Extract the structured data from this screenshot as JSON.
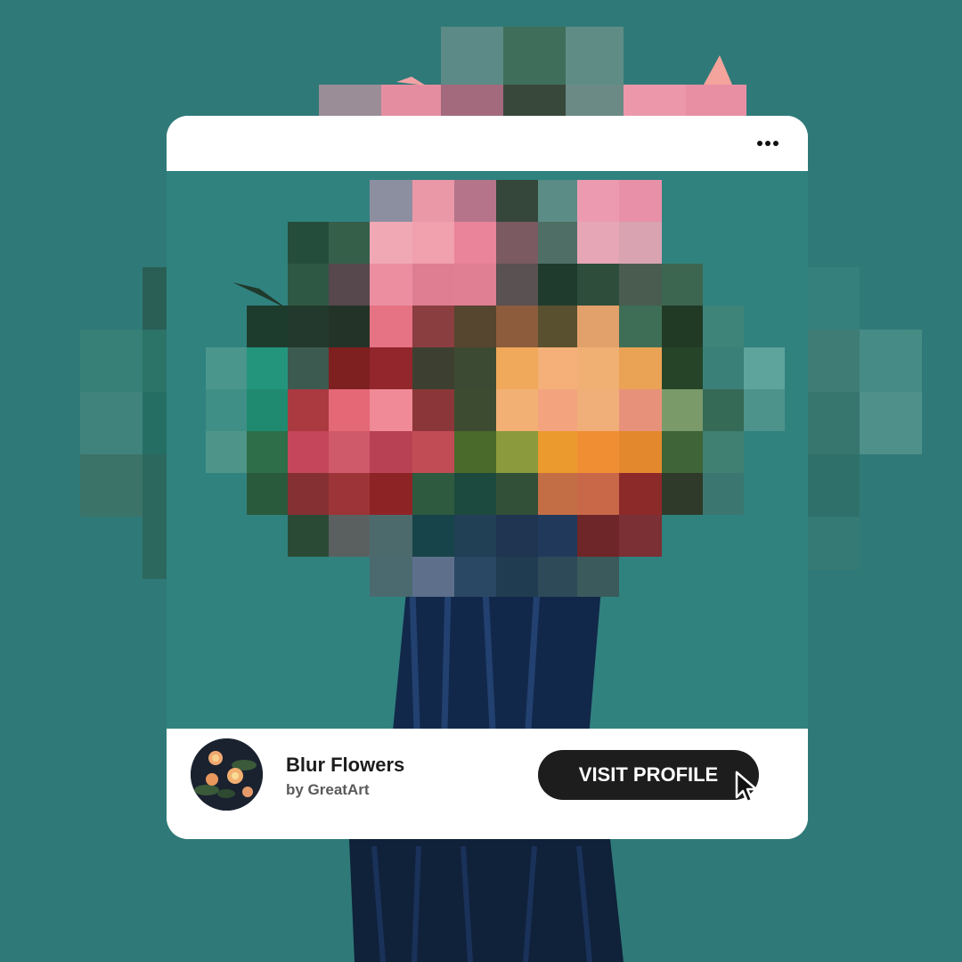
{
  "post": {
    "title": "Blur Flowers",
    "author": "by GreatArt",
    "visit_button_label": "VISIT PROFILE"
  },
  "icons": {
    "more": "more-dots-icon",
    "cursor": "cursor-pointer-icon"
  },
  "colors": {
    "background_teal": "#2f7a78",
    "card_white": "#ffffff",
    "button_dark": "#1d1d1d",
    "title_text": "#1d1d1d",
    "author_text": "#5a5a5a"
  }
}
